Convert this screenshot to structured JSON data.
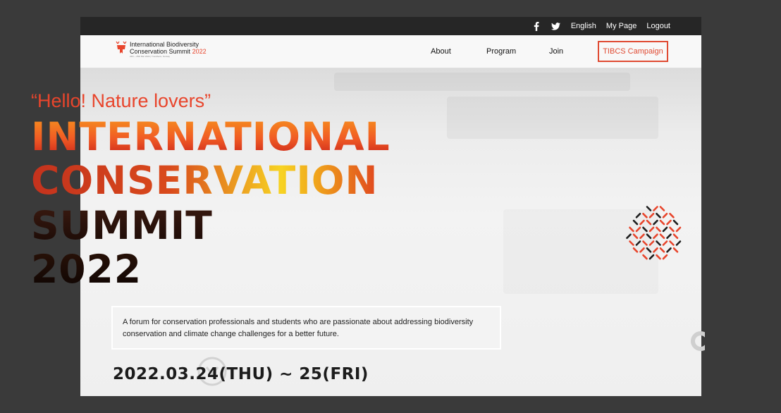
{
  "topbar": {
    "icons": [
      "facebook-icon",
      "twitter-icon"
    ],
    "language": "English",
    "mypage": "My Page",
    "logout": "Logout"
  },
  "logo": {
    "line1": "International Biodiversity",
    "line2": "Conservation Summit",
    "year": "2022",
    "line3": "24th ~ 25th Mar 2022 | Trondheim, Norway"
  },
  "nav": {
    "about": "About",
    "program": "Program",
    "join": "Join",
    "campaign": "TIBCS Campaign"
  },
  "hero": {
    "tagline": "“Hello! Nature lovers”",
    "title_line1": "INTERNATIONAL",
    "title_line2": "CONSERVATION",
    "title_line3": "SUMMIT",
    "title_line4": "2022",
    "description": "A forum for conservation professionals and students who are passionate about addressing biodiversity conservation and climate change challenges for a better future.",
    "dates": "2022.03.24(THU) ~ 25(FRI)"
  },
  "colors": {
    "accent": "#e8452c",
    "topbar_bg": "#262626",
    "page_bg": "#3a3a3a"
  }
}
